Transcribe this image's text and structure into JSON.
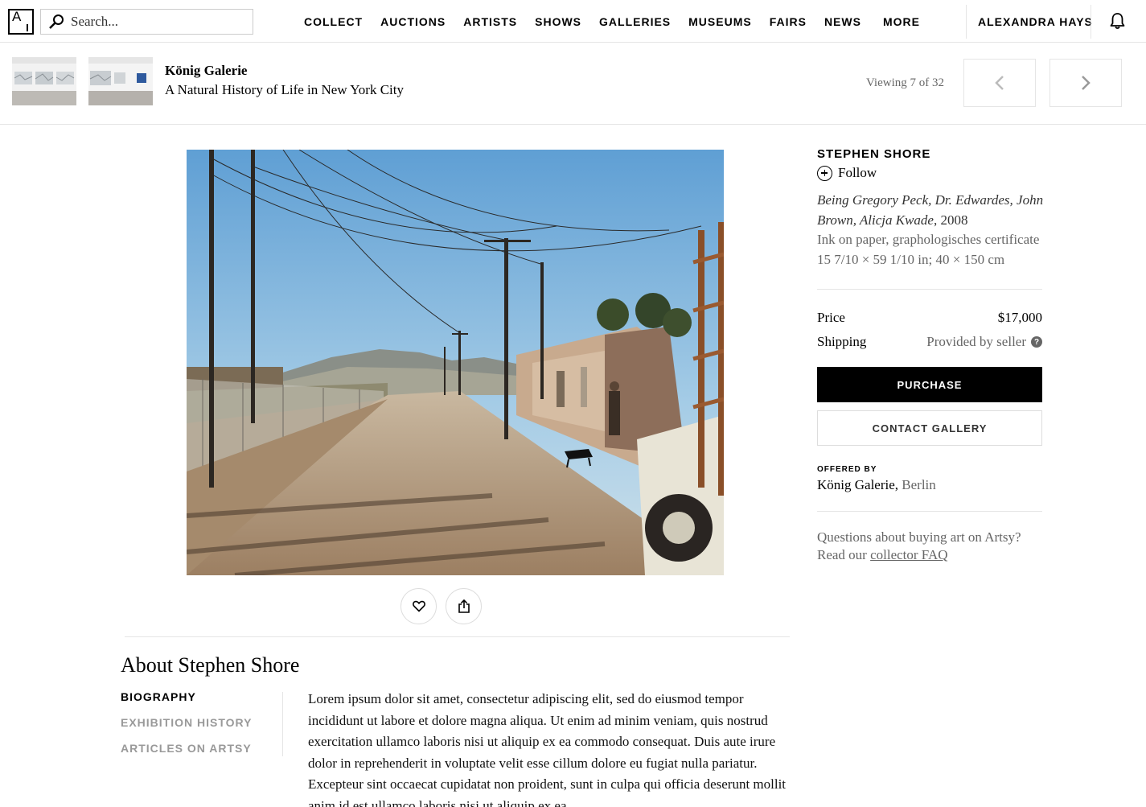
{
  "nav": {
    "logo_letter": "A",
    "search_placeholder": "Search...",
    "links": [
      "COLLECT",
      "AUCTIONS",
      "ARTISTS",
      "SHOWS",
      "GALLERIES",
      "MUSEUMS",
      "FAIRS",
      "NEWS",
      "MORE"
    ],
    "user": "ALEXANDRA HAYS"
  },
  "show": {
    "gallery": "König Galerie",
    "title": "A Natural History of Life in New York City",
    "viewing": "Viewing 7 of 32"
  },
  "artwork": {
    "artist": "STEPHEN SHORE",
    "follow_label": "Follow",
    "title": "Being Gregory Peck, Dr. Edwardes, John Brown, Alicja Kwade",
    "year": ", 2008",
    "medium": "Ink on paper, graphologisches certificate",
    "dimensions": "15 7/10 × 59 1/10 in; 40 × 150 cm",
    "price_label": "Price",
    "price": "$17,000",
    "shipping_label": "Shipping",
    "shipping": "Provided by seller",
    "shipping_help": "?",
    "purchase_label": "PURCHASE",
    "contact_label": "CONTACT GALLERY",
    "offered_label": "OFFERED BY",
    "offered_gallery": "König Galerie,",
    "offered_city": "Berlin",
    "faq_text": "Questions about buying art on Artsy?",
    "faq_read": "Read our ",
    "faq_link": "collector FAQ"
  },
  "about": {
    "title": "About Stephen Shore",
    "tabs": [
      "BIOGRAPHY",
      "EXHIBITION HISTORY",
      "ARTICLES ON ARTSY"
    ],
    "bio": "Lorem ipsum dolor sit amet, consectetur adipiscing elit, sed do eiusmod tempor incididunt ut labore et dolore magna aliqua. Ut enim ad minim veniam, quis nostrud exercitation ullamco laboris nisi ut aliquip ex ea commodo consequat. Duis aute irure dolor in reprehenderit in voluptate velit esse cillum dolore eu fugiat nulla pariatur. Excepteur sint occaecat cupidatat non proident, sunt in culpa qui officia deserunt mollit anim id est ullamco laboris nisi ut aliquip ex ea"
  },
  "icons": {
    "search": "search-icon",
    "bell": "bell-icon",
    "prev": "chevron-left-icon",
    "next": "chevron-right-icon",
    "heart": "heart-icon",
    "share": "share-icon",
    "plus": "plus-circle-icon"
  }
}
